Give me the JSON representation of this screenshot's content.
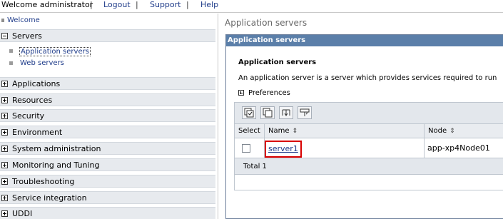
{
  "topbar": {
    "welcome": "Welcome administrator",
    "separator": "|",
    "logout": "Logout",
    "support": "Support",
    "help": "Help"
  },
  "nav": {
    "welcome_link": "Welcome",
    "servers": {
      "label": "Servers",
      "expanded": true,
      "children": [
        "Application servers",
        "Web servers"
      ]
    },
    "items": [
      "Applications",
      "Resources",
      "Security",
      "Environment",
      "System administration",
      "Monitoring and Tuning",
      "Troubleshooting",
      "Service integration",
      "UDDI"
    ]
  },
  "main": {
    "breadcrumb": "Application servers",
    "frame_title": "Application servers",
    "section_title": "Application servers",
    "description": "An application server is a server which provides services required to run",
    "preferences": "Preferences",
    "toolbar_icons": [
      "select-all-icon",
      "deselect-all-icon",
      "filter-icon",
      "query-icon"
    ],
    "table": {
      "columns": [
        "Select",
        "Name",
        "Node"
      ],
      "sort_icon": "⇕",
      "rows": [
        {
          "name": "server1",
          "node": "app-xp4Node01",
          "selected": false
        }
      ],
      "total": "Total 1"
    }
  },
  "colors": {
    "link": "#1f3c8a",
    "frame_header": "#5b7fa9",
    "nav_item_bg": "#e7eaee",
    "highlight_box": "#d80000"
  }
}
